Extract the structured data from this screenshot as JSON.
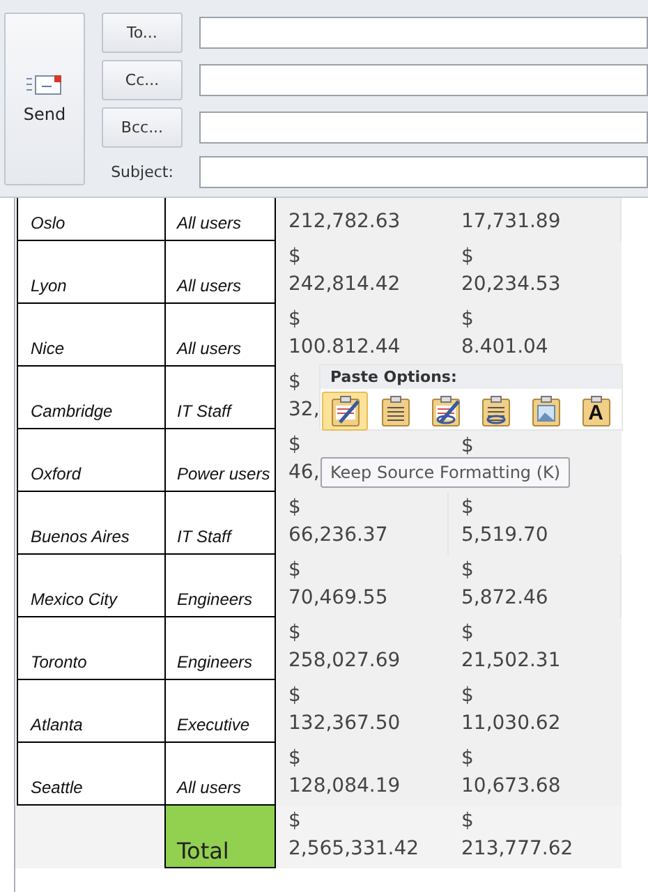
{
  "header": {
    "send_button": "Send",
    "address_buttons": [
      "To...",
      "Cc...",
      "Bcc..."
    ],
    "subject_label": "Subject:"
  },
  "table": {
    "rows": [
      {
        "city": "Oslo",
        "group": "All users",
        "amounts": [
          {
            "value": "212,782.63"
          },
          {
            "value": "17,731.89"
          }
        ]
      },
      {
        "city": "Lyon",
        "group": "All users",
        "amounts": [
          {
            "dollar": "$",
            "value": "242,814.42"
          },
          {
            "dollar": "$",
            "value": "20,234.53"
          }
        ]
      },
      {
        "city": "Nice",
        "group": "All users",
        "amounts": [
          {
            "dollar": "$",
            "value": "100.812.44"
          },
          {
            "dollar": "$",
            "value": "8.401.04"
          }
        ]
      },
      {
        "city": "Cambridge",
        "group": "IT Staff",
        "amounts": [
          {
            "dollar": "$",
            "value": "32,"
          }
        ]
      },
      {
        "city": "Oxford",
        "group": "Power users",
        "amounts": [
          {
            "dollar": "$",
            "value": "46,"
          },
          {
            "dollar": "$"
          }
        ]
      },
      {
        "city": "Buenos Aires",
        "group": "IT Staff",
        "amounts": [
          {
            "dollar": "$",
            "value": "66,236.37"
          },
          {
            "dollar": "$",
            "value": "5,519.70"
          }
        ]
      },
      {
        "city": "Mexico City",
        "group": "Engineers",
        "amounts": [
          {
            "dollar": "$",
            "value": "70,469.55"
          },
          {
            "dollar": "$",
            "value": "5,872.46"
          }
        ]
      },
      {
        "city": "Toronto",
        "group": "Engineers",
        "amounts": [
          {
            "dollar": "$",
            "value": "258,027.69"
          },
          {
            "dollar": "$",
            "value": "21,502.31"
          }
        ]
      },
      {
        "city": "Atlanta",
        "group": "Executive",
        "amounts": [
          {
            "dollar": "$",
            "value": "132,367.50"
          },
          {
            "dollar": "$",
            "value": "11,030.62"
          }
        ]
      },
      {
        "city": "Seattle",
        "group": "All users",
        "amounts": [
          {
            "dollar": "$",
            "value": "128,084.19"
          },
          {
            "dollar": "$",
            "value": "10,673.68"
          }
        ]
      }
    ],
    "total": {
      "label": "Total",
      "amounts": [
        {
          "dollar": "$",
          "value": "2,565,331.42"
        },
        {
          "dollar": "$",
          "value": "213,777.62"
        }
      ]
    }
  },
  "paste_options": {
    "title": "Paste Options:",
    "options": [
      {
        "kind": "brush",
        "selected": true
      },
      {
        "kind": "text",
        "selected": false
      },
      {
        "kind": "brush-link",
        "selected": false
      },
      {
        "kind": "link",
        "selected": false
      },
      {
        "kind": "picture",
        "selected": false
      },
      {
        "kind": "letter",
        "label": "A",
        "selected": false
      }
    ]
  },
  "tooltip": "Keep Source Formatting (K)"
}
